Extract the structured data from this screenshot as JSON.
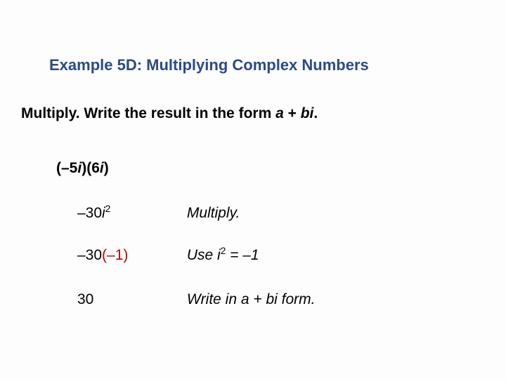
{
  "title": "Example 5D: Multiplying Complex Numbers",
  "instruction": {
    "lead": "Multiply. Write the result in the form ",
    "a": "a",
    "plus": " + ",
    "b": "b",
    "i": "i",
    "dot": "."
  },
  "problem": {
    "open1": "(",
    "m5": "–5",
    "i1": "i",
    "close1": ")",
    "open2": "(",
    "six": "6",
    "i2": "i",
    "close2": ")"
  },
  "step1": {
    "m30": "–30",
    "i": "i",
    "sq": "2",
    "note": "Multiply."
  },
  "step2": {
    "m30": "–30",
    "open": "(",
    "m1": "–1",
    "close": ")",
    "note_lead": "Use ",
    "note_i": "i",
    "note_sq": "2",
    "note_eq": " = ",
    "note_m1": "–1"
  },
  "step3": {
    "val": "30",
    "note": "Write in a + bi form."
  }
}
